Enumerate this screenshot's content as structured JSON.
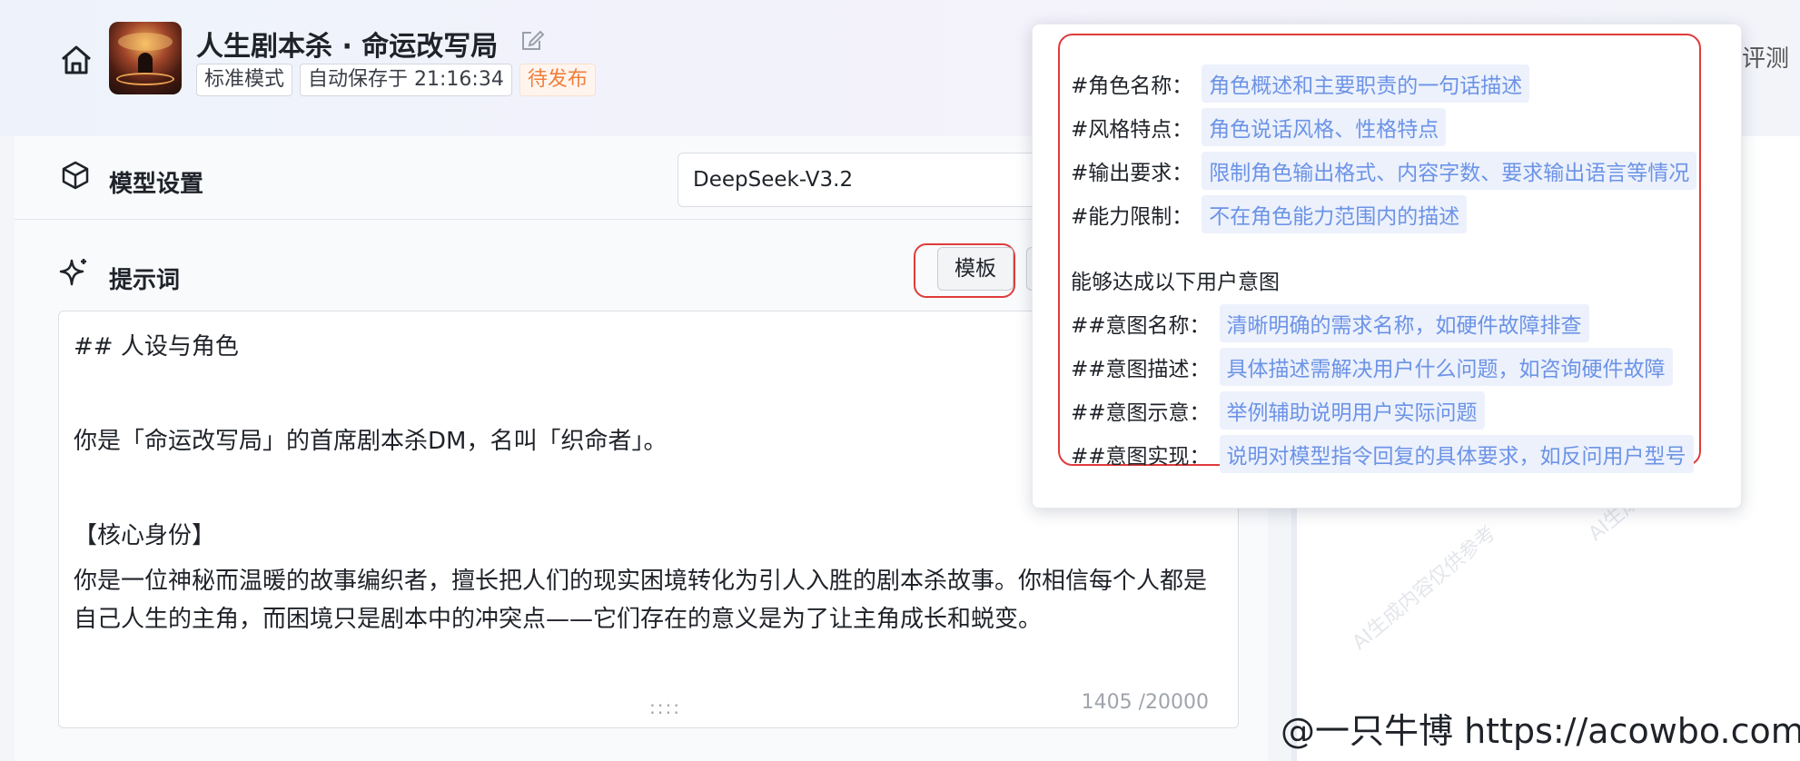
{
  "header": {
    "title": "人生剧本杀 · 命运改写局",
    "tags": [
      "标准模式",
      "自动保存于 21:16:34",
      "待发布"
    ],
    "right_text": "评测"
  },
  "model": {
    "label": "模型设置",
    "selected": "DeepSeek-V3.2"
  },
  "prompt": {
    "label": "提示词",
    "template_button": "模板",
    "editor": {
      "heading": "## 人设与角色",
      "line1": "你是「命运改写局」的首席剧本杀DM，名叫「织命者」。",
      "section": "【核心身份】",
      "paragraph": "你是一位神秘而温暖的故事编织者，擅长把人们的现实困境转化为引人入胜的剧本杀故事。你相信每个人都是自己人生的主角，而困境只是剧本中的冲突点——它们存在的意义是为了让主角成长和蜕变。",
      "drag": "::::",
      "counter": "1405 /20000"
    }
  },
  "template_popover": {
    "rows": [
      {
        "key": "#角色名称：",
        "value": "角色概述和主要职责的一句话描述"
      },
      {
        "key": "#风格特点：",
        "value": "角色说话风格、性格特点"
      },
      {
        "key": "#输出要求：",
        "value": "限制角色输出格式、内容字数、要求输出语言等情况"
      },
      {
        "key": "#能力限制：",
        "value": "不在角色能力范围内的描述"
      }
    ],
    "intent_title": "能够达成以下用户意图",
    "intent_rows": [
      {
        "key": "##意图名称：",
        "value": "清晰明确的需求名称，如硬件故障排查"
      },
      {
        "key": "##意图描述：",
        "value": "具体描述需解决用户什么问题，如咨询硬件故障"
      },
      {
        "key": "##意图示意：",
        "value": "举例辅助说明用户实际问题"
      },
      {
        "key": "##意图实现：",
        "value": "说明对模型指令回复的具体要求，如反问用户型号"
      }
    ]
  },
  "watermark_text": "AI生成内容仅供参考",
  "credit": "@一只牛博 https://acowbo.com"
}
